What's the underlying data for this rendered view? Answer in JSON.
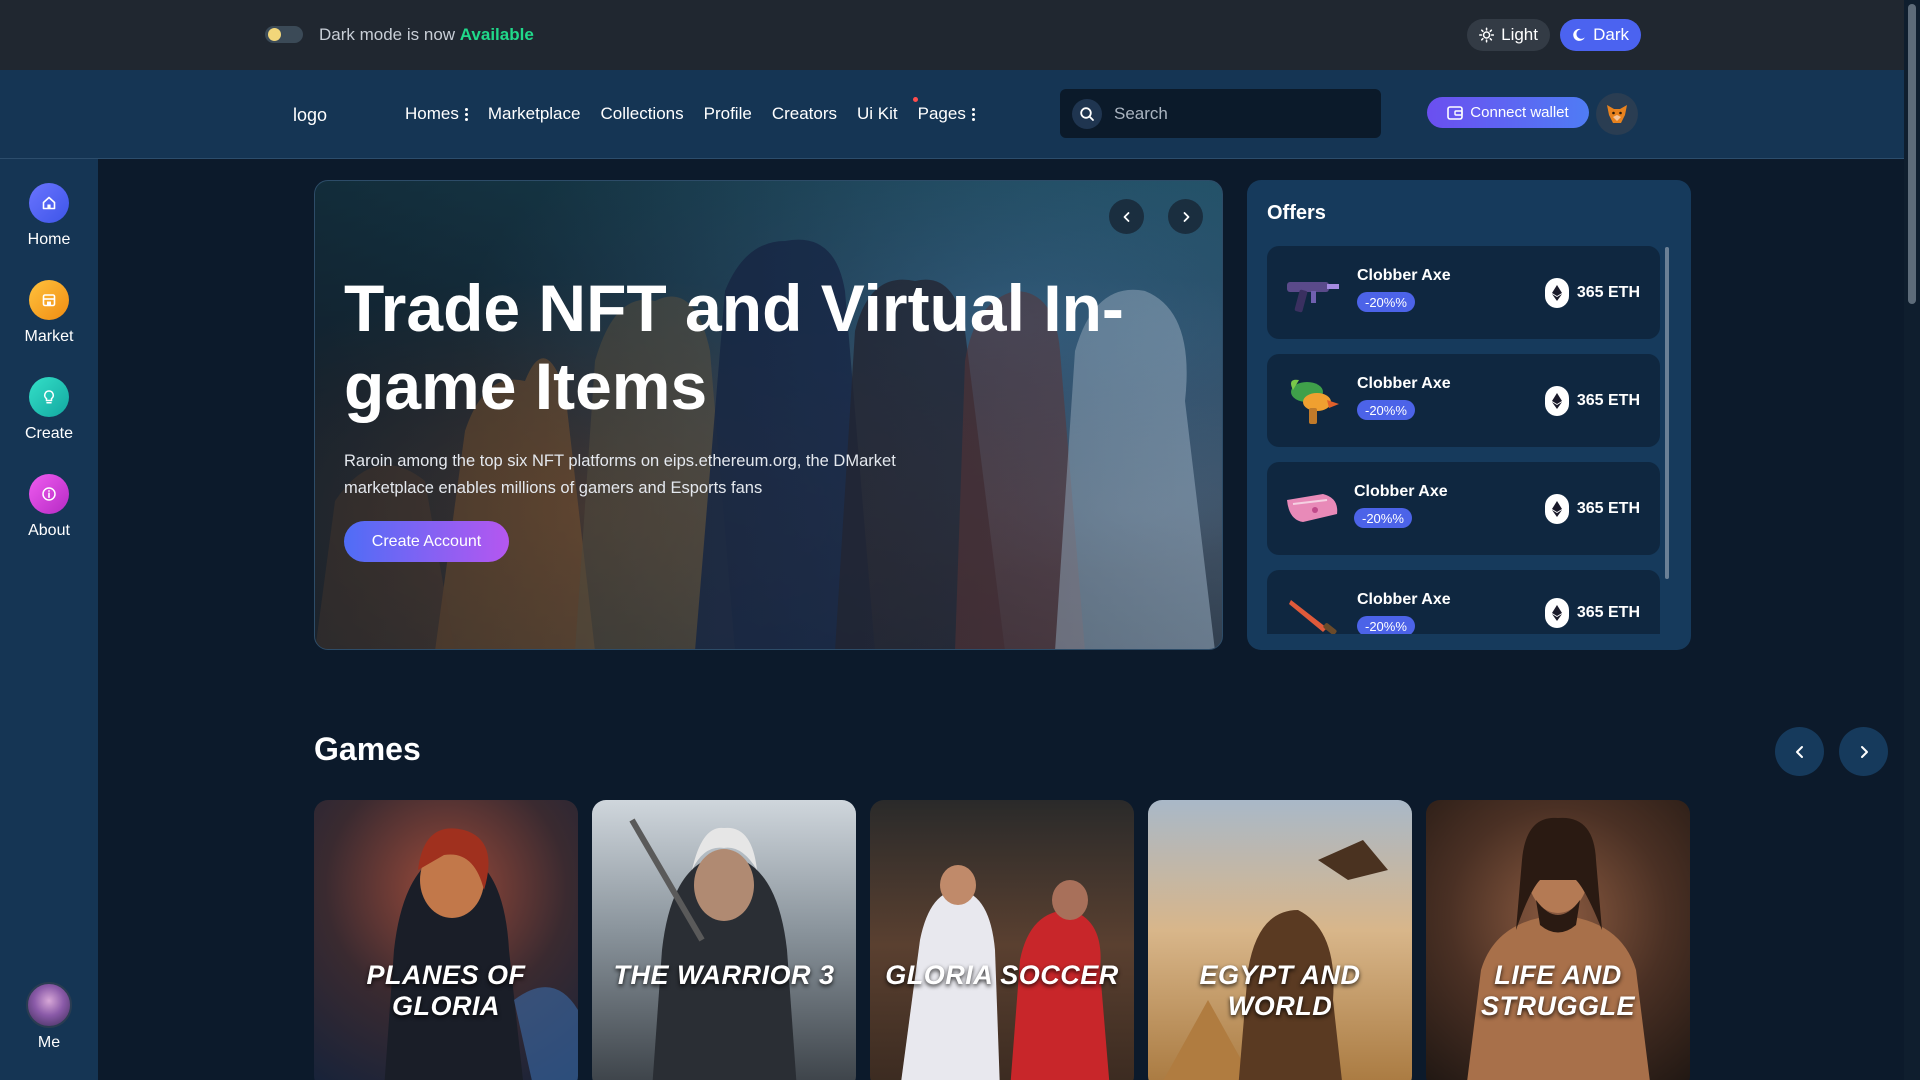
{
  "topbar": {
    "dark_note_prefix": "Dark mode is now ",
    "dark_note_highlight": "Available",
    "light_label": "Light",
    "dark_label": "Dark"
  },
  "navbar": {
    "logo": "logo",
    "items": [
      {
        "label": "Homes",
        "has_menu": true
      },
      {
        "label": "Marketplace"
      },
      {
        "label": "Collections"
      },
      {
        "label": "Profile"
      },
      {
        "label": "Creators"
      },
      {
        "label": "Ui Kit"
      },
      {
        "label": "Pages",
        "has_menu": true
      }
    ],
    "search_placeholder": "Search",
    "connect_label": "Connect wallet"
  },
  "sidebar": {
    "items": [
      {
        "label": "Home",
        "icon": "home-icon",
        "color": "#4b63f0"
      },
      {
        "label": "Market",
        "icon": "store-icon",
        "color": "#f2a61b"
      },
      {
        "label": "Create",
        "icon": "lightbulb-icon",
        "color": "#1fc8b3"
      },
      {
        "label": "About",
        "icon": "info-icon",
        "color": "#d73fd8"
      }
    ],
    "me_label": "Me"
  },
  "hero": {
    "title": "Trade NFT and Virtual In-game Items",
    "description": "Raroin among the top six NFT platforms on eips.ethereum.org, the DMarket marketplace enables millions of gamers and Esports fans",
    "cta_label": "Create Account"
  },
  "offers": {
    "title": "Offers",
    "items": [
      {
        "name": "Clobber Axe",
        "discount": "-20%%",
        "price": "365 ETH",
        "thumb": "gun-thumb-icon"
      },
      {
        "name": "Clobber Axe",
        "discount": "-20%%",
        "price": "365 ETH",
        "thumb": "parrot-gun-thumb-icon"
      },
      {
        "name": "Clobber Axe",
        "discount": "-20%%",
        "price": "365 ETH",
        "thumb": "pink-glove-thumb-icon"
      },
      {
        "name": "Clobber Axe",
        "discount": "-20%%",
        "price": "365 ETH",
        "thumb": "knife-thumb-icon"
      }
    ]
  },
  "games": {
    "title": "Games",
    "items": [
      {
        "title": "PLANES OF GLORIA"
      },
      {
        "title": "THE WARRIOR 3"
      },
      {
        "title": "GLORIA SOCCER"
      },
      {
        "title": "EGYPT AND WORLD"
      },
      {
        "title": "LIFE AND STRUGGLE"
      }
    ]
  },
  "colors": {
    "accent": "#4b63f0",
    "available_green": "#20d98a",
    "badge_blue": "#4c63e8",
    "panel": "#163a5c",
    "background": "#0c1a2b"
  }
}
